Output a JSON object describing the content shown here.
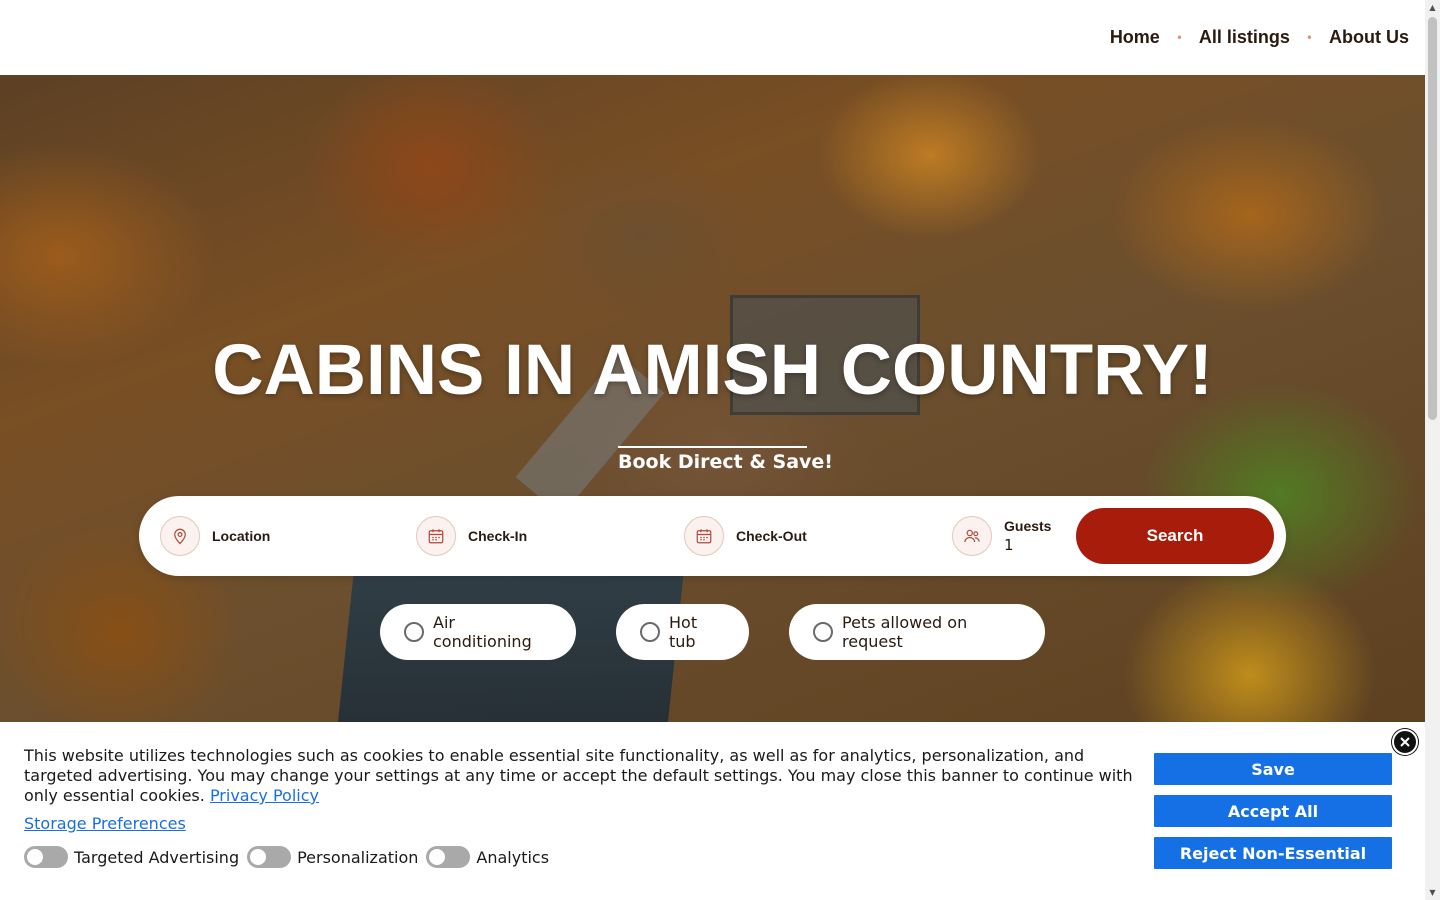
{
  "nav": {
    "items": [
      {
        "label": "Home"
      },
      {
        "label": "All listings"
      },
      {
        "label": "About Us"
      }
    ],
    "separator": "•"
  },
  "hero": {
    "title": "CABINS IN AMISH COUNTRY!",
    "subtitle": "Book Direct & Save!"
  },
  "search": {
    "location_label": "Location",
    "checkin_label": "Check-In",
    "checkout_label": "Check-Out",
    "guests_label": "Guests",
    "guests_value": "1",
    "button_label": "Search",
    "accent_color": "#a81c0c"
  },
  "amenities": [
    {
      "label": "Air conditioning"
    },
    {
      "label": "Hot tub"
    },
    {
      "label": "Pets allowed on request"
    }
  ],
  "cookie_banner": {
    "text": "This website utilizes technologies such as cookies to enable essential site functionality, as well as for analytics, personalization, and targeted advertising. You may change your settings at any time or accept the default settings. You may close this banner to continue with only essential cookies.",
    "privacy_link": "Privacy Policy",
    "storage_link": "Storage Preferences",
    "toggles": [
      {
        "label": "Targeted Advertising",
        "on": false
      },
      {
        "label": "Personalization",
        "on": false
      },
      {
        "label": "Analytics",
        "on": false
      }
    ],
    "save_label": "Save",
    "accept_label": "Accept All",
    "reject_label": "Reject Non-Essential",
    "button_color": "#1570e6"
  }
}
